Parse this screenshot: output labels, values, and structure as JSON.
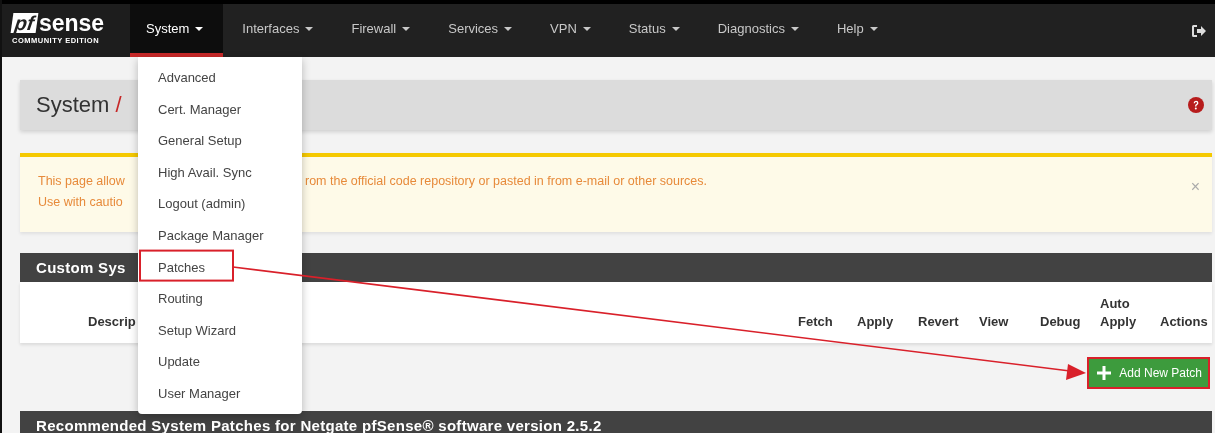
{
  "logo": {
    "mark": "pf",
    "name": "sense",
    "edition": "COMMUNITY EDITION"
  },
  "nav": [
    {
      "label": "System",
      "selected": true
    },
    {
      "label": "Interfaces",
      "selected": false
    },
    {
      "label": "Firewall",
      "selected": false
    },
    {
      "label": "Services",
      "selected": false
    },
    {
      "label": "VPN",
      "selected": false
    },
    {
      "label": "Status",
      "selected": false
    },
    {
      "label": "Diagnostics",
      "selected": false
    },
    {
      "label": "Help",
      "selected": false
    }
  ],
  "dropdown": {
    "expanded": true,
    "items": [
      {
        "label": "Advanced",
        "highlighted": false
      },
      {
        "label": "Cert. Manager",
        "highlighted": false
      },
      {
        "label": "General Setup",
        "highlighted": false
      },
      {
        "label": "High Avail. Sync",
        "highlighted": false
      },
      {
        "label": "Logout (admin)",
        "highlighted": false
      },
      {
        "label": "Package Manager",
        "highlighted": false
      },
      {
        "label": "Patches",
        "highlighted": true
      },
      {
        "label": "Routing",
        "highlighted": false
      },
      {
        "label": "Setup Wizard",
        "highlighted": false
      },
      {
        "label": "Update",
        "highlighted": false
      },
      {
        "label": "User Manager",
        "highlighted": false
      }
    ]
  },
  "breadcrumb": {
    "section": "System",
    "separator": "/"
  },
  "alert": {
    "line_1_left": "This page allow",
    "line_1_right": "rom the official code repository or pasted in from e-mail or other sources.",
    "line_2_left": "Use with cautio",
    "close": "×"
  },
  "custom_panel": {
    "title": "Custom Sys",
    "columns": [
      "Descrip",
      "Fetch",
      "Apply",
      "Revert",
      "View",
      "Debug",
      "Auto Apply",
      "Actions"
    ]
  },
  "add_button": {
    "label": "Add New Patch",
    "highlighted": true
  },
  "recommended_panel": {
    "title": "Recommended System Patches for Netgate pfSense® software version 2.5.2"
  },
  "annotation": {
    "arrow": true
  }
}
